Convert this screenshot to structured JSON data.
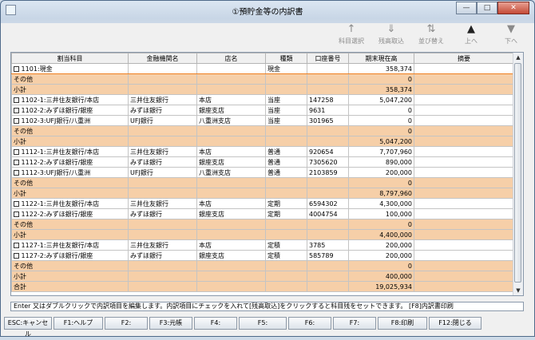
{
  "window": {
    "title": "①預貯金等の内訳書",
    "controls": {
      "minimize": "—",
      "maximize": "□",
      "close": "✕"
    }
  },
  "toolbar": [
    {
      "key": "subject_select",
      "label": "科目選択",
      "icon": "↑",
      "enabled": false
    },
    {
      "key": "balance_fetch",
      "label": "残高取込",
      "icon": "⇓",
      "enabled": false
    },
    {
      "key": "sort",
      "label": "並び替え",
      "icon": "⇅",
      "enabled": false
    },
    {
      "key": "up",
      "label": "上へ",
      "icon": "▲",
      "enabled": true
    },
    {
      "key": "down",
      "label": "下へ",
      "icon": "▼",
      "enabled": false
    }
  ],
  "grid": {
    "columns": [
      "割当科目",
      "金融機関名",
      "店名",
      "種類",
      "口座番号",
      "期末現在高",
      "摘要"
    ],
    "rows": [
      {
        "type": "data",
        "sel": true,
        "subject": "1101:現金",
        "bank": "",
        "branch": "",
        "kind": "現金",
        "account": "",
        "amount": "358,374",
        "note": ""
      },
      {
        "type": "other",
        "subject": "その他",
        "amount": "0"
      },
      {
        "type": "subtotal",
        "subject": "小計",
        "amount": "358,374"
      },
      {
        "type": "data",
        "subject": "1102-1:三井住友銀行/本店",
        "bank": "三井住友銀行",
        "branch": "本店",
        "kind": "当座",
        "account": "147258",
        "amount": "5,047,200",
        "note": ""
      },
      {
        "type": "data",
        "subject": "1102-2:みずほ銀行/銀座",
        "bank": "みずほ銀行",
        "branch": "銀座支店",
        "kind": "当座",
        "account": "9631",
        "amount": "0",
        "note": ""
      },
      {
        "type": "data",
        "subject": "1102-3:UFJ銀行/八重洲",
        "bank": "UFJ銀行",
        "branch": "八重洲支店",
        "kind": "当座",
        "account": "301965",
        "amount": "0",
        "note": ""
      },
      {
        "type": "other",
        "subject": "その他",
        "amount": "0"
      },
      {
        "type": "subtotal",
        "subject": "小計",
        "amount": "5,047,200"
      },
      {
        "type": "data",
        "subject": "1112-1:三井住友銀行/本店",
        "bank": "三井住友銀行",
        "branch": "本店",
        "kind": "普通",
        "account": "920654",
        "amount": "7,707,960",
        "note": ""
      },
      {
        "type": "data",
        "subject": "1112-2:みずほ銀行/銀座",
        "bank": "みずほ銀行",
        "branch": "銀座支店",
        "kind": "普通",
        "account": "7305620",
        "amount": "890,000",
        "note": ""
      },
      {
        "type": "data",
        "subject": "1112-3:UFJ銀行/八重洲",
        "bank": "UFJ銀行",
        "branch": "八重洲支店",
        "kind": "普通",
        "account": "2103859",
        "amount": "200,000",
        "note": ""
      },
      {
        "type": "other",
        "subject": "その他",
        "amount": "0"
      },
      {
        "type": "subtotal",
        "subject": "小計",
        "amount": "8,797,960"
      },
      {
        "type": "data",
        "subject": "1122-1:三井住友銀行/本店",
        "bank": "三井住友銀行",
        "branch": "本店",
        "kind": "定期",
        "account": "6594302",
        "amount": "4,300,000",
        "note": ""
      },
      {
        "type": "data",
        "subject": "1122-2:みずほ銀行/銀座",
        "bank": "みずほ銀行",
        "branch": "銀座支店",
        "kind": "定期",
        "account": "4004754",
        "amount": "100,000",
        "note": ""
      },
      {
        "type": "other",
        "subject": "その他",
        "amount": "0"
      },
      {
        "type": "subtotal",
        "subject": "小計",
        "amount": "4,400,000"
      },
      {
        "type": "data",
        "subject": "1127-1:三井住友銀行/本店",
        "bank": "三井住友銀行",
        "branch": "本店",
        "kind": "定積",
        "account": "3785",
        "amount": "200,000",
        "note": ""
      },
      {
        "type": "data",
        "subject": "1127-2:みずほ銀行/銀座",
        "bank": "みずほ銀行",
        "branch": "銀座支店",
        "kind": "定積",
        "account": "585789",
        "amount": "200,000",
        "note": ""
      },
      {
        "type": "other",
        "subject": "その他",
        "amount": "0"
      },
      {
        "type": "subtotal",
        "subject": "小計",
        "amount": "400,000"
      },
      {
        "type": "total",
        "subject": "合計",
        "amount": "19,025,934"
      }
    ]
  },
  "status_text": "Enter 又はダブルクリックで内訳項目を編集します。内訳項目にチェックを入れて[残高取込]をクリックすると科目残をセットできます。 [F8]内訳書印刷",
  "fkeys": [
    {
      "key": "esc",
      "label": "ESC:キャンセル"
    },
    {
      "key": "f1",
      "label": "F1:ヘルプ"
    },
    {
      "key": "f2",
      "label": "F2:"
    },
    {
      "key": "f3",
      "label": "F3:元帳"
    },
    {
      "key": "f4",
      "label": "F4:"
    },
    {
      "key": "f5",
      "label": "F5:"
    },
    {
      "key": "f6",
      "label": "F6:"
    },
    {
      "key": "f7",
      "label": "F7:"
    },
    {
      "key": "f8",
      "label": "F8:印刷"
    },
    {
      "key": "f12",
      "label": "F12:閉じる"
    }
  ]
}
